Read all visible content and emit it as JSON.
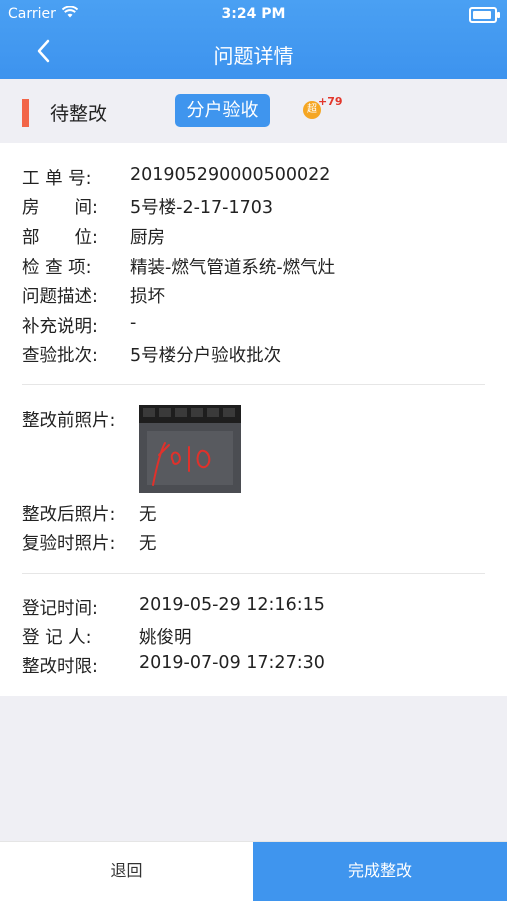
{
  "status_bar": {
    "carrier": "Carrier",
    "time": "3:24 PM"
  },
  "nav": {
    "title": "问题详情"
  },
  "status_row": {
    "status": "待整改",
    "tag": "分户验收",
    "badge_icon": "超",
    "badge_count": "+79"
  },
  "details": [
    {
      "label": "工 单 号:",
      "value": "201905290000500022"
    },
    {
      "label": "房　　间:",
      "value": "5号楼-2-17-1703"
    },
    {
      "label": "部　　位:",
      "value": "厨房"
    },
    {
      "label": "检 查 项:",
      "value": "精装-燃气管道系统-燃气灶"
    },
    {
      "label": "问题描述:",
      "value": "损坏"
    },
    {
      "label": "补充说明:",
      "value": "-"
    },
    {
      "label": "查验批次:",
      "value": "5号楼分户验收批次"
    }
  ],
  "photos": {
    "before_label": "整改前照片:",
    "after_label": "整改后照片:",
    "after_value": "无",
    "recheck_label": "复验时照片:",
    "recheck_value": "无"
  },
  "record": [
    {
      "label": "登记时间:",
      "value": "2019-05-29 12:16:15"
    },
    {
      "label": "登 记 人:",
      "value": "姚俊明"
    },
    {
      "label": "整改时限:",
      "value": "2019-07-09 17:27:30"
    }
  ],
  "bottom": {
    "back_label": "退回",
    "complete_label": "完成整改"
  },
  "colors": {
    "primary": "#3f95ee",
    "status_indicator": "#f26548"
  },
  "icons": [
    "wifi-icon",
    "battery-icon",
    "back-arrow-icon",
    "badge-icon"
  ]
}
